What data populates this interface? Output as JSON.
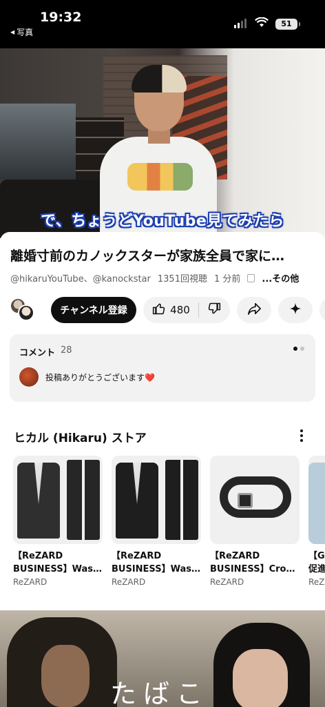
{
  "status_bar": {
    "time": "19:32",
    "back_label": "写真",
    "battery": "51"
  },
  "video": {
    "caption": "で、ちょうどYouTube見てみたら"
  },
  "info": {
    "title": "離婚寸前のカノックスターが家族全員で家に…",
    "channels": "@hikaruYouTube、@kanockstar",
    "views": "1351回視聴",
    "time_ago": "1 分前",
    "more": "...その他"
  },
  "actions": {
    "subscribe_label": "チャンネル登録",
    "like_count": "480"
  },
  "comments": {
    "label": "コメント",
    "count": "28",
    "top_comment": "投稿ありがとうございます❤️"
  },
  "store": {
    "title": "ヒカル (Hikaru) ストア",
    "products": [
      {
        "line1": "【ReZARD",
        "line2": "BUSINESS】Was…",
        "brand": "ReZARD"
      },
      {
        "line1": "【ReZARD",
        "line2": "BUSINESS】Was…",
        "brand": "ReZARD"
      },
      {
        "line1": "【ReZARD",
        "line2": "BUSINESS】Cro…",
        "brand": "ReZARD"
      },
      {
        "line1": "【Go",
        "line2": "促進",
        "brand": "ReZ"
      }
    ]
  },
  "next_video": {
    "caption": "たばこ"
  },
  "colors": {
    "subscribe_bg": "#0f0f0f",
    "pill_bg": "#f2f2f2",
    "caption_outline": "#1d3fb0"
  }
}
